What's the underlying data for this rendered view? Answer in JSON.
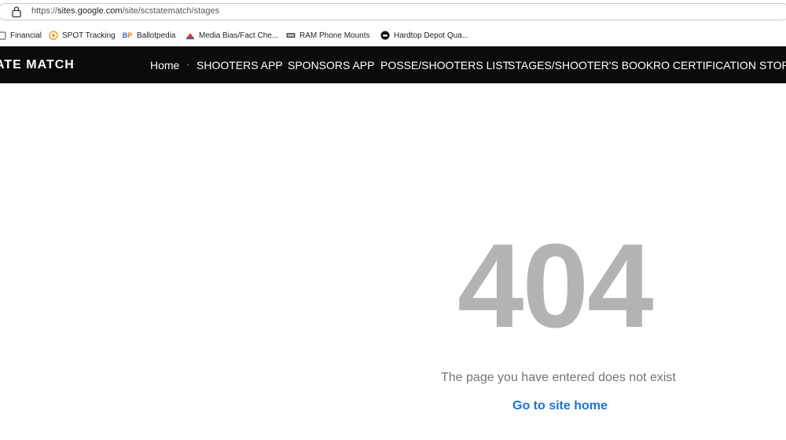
{
  "browser": {
    "url_prefix": "https://",
    "url_host": "sites.google.com",
    "url_path": "/site/scstatematch/stages"
  },
  "bookmarks": [
    {
      "label": "Financial",
      "icon": "folder-icon"
    },
    {
      "label": "SPOT Tracking",
      "icon": "spot-icon"
    },
    {
      "label": "Ballotpedia",
      "icon": "bp-icon"
    },
    {
      "label": "Media Bias/Fact Che...",
      "icon": "mediabias-icon"
    },
    {
      "label": "RAM Phone Mounts",
      "icon": "ram-icon"
    },
    {
      "label": "Hardtop Depot Qua...",
      "icon": "hardtop-icon"
    }
  ],
  "site": {
    "title": "ATE MATCH",
    "nav": [
      "Home",
      "SHOOTERS APP",
      "SPONSORS APP",
      "POSSE/SHOOTERS LIST",
      "STAGES/SHOOTER'S BOOK",
      "RO CERTIFICATION",
      "STOR"
    ],
    "separator": "·"
  },
  "error": {
    "code": "404",
    "message": "The page you have entered does not exist",
    "link": "Go to site home"
  },
  "colors": {
    "nav_bg": "#0b0b0b",
    "code": "#b3b3b3",
    "link": "#1a73e8",
    "message": "#757575"
  }
}
